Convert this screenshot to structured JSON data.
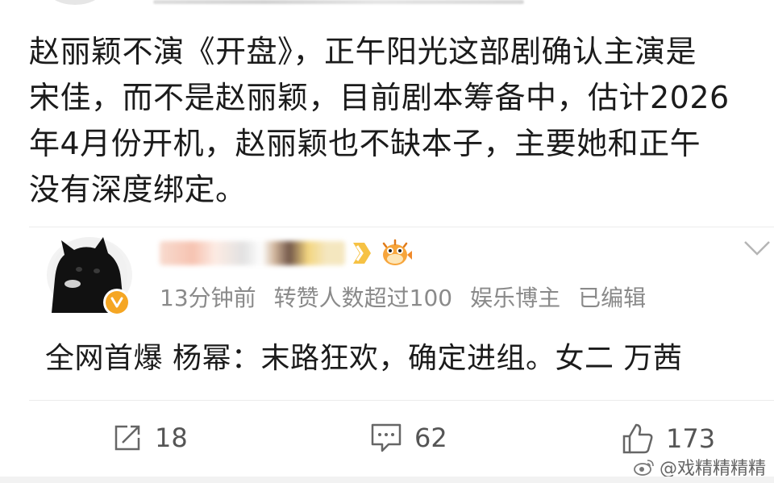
{
  "post": {
    "lines": [
      "赵丽颖不演《开盘》，正午阳光这部剧确认主演是",
      "宋佳，而不是赵丽颖，目前剧本筹备中，估计2026",
      "年4月份开机，赵丽颖也不缺本子，主要她和正午",
      "没有深度绑定。"
    ]
  },
  "comment": {
    "meta": {
      "time": "13分钟前",
      "reposts_note": "转赞人数超过100",
      "role": "娱乐博主",
      "edited": "已编辑"
    },
    "text": "全网首爆  杨幂：末路狂欢，确定进组。女二 万茜",
    "icons": [
      "avatar",
      "verified-badge-icon",
      "level-badge-icon",
      "pufferfish-badge-icon",
      "chevron-down-icon"
    ]
  },
  "actions": {
    "repost_count": "18",
    "comment_count": "62",
    "like_count": "173"
  },
  "watermark": {
    "text": "@戏精精精精"
  },
  "colors": {
    "verified": "#f5a623",
    "meta_text": "#8a8a8a",
    "body_text": "#1b1b1b"
  }
}
